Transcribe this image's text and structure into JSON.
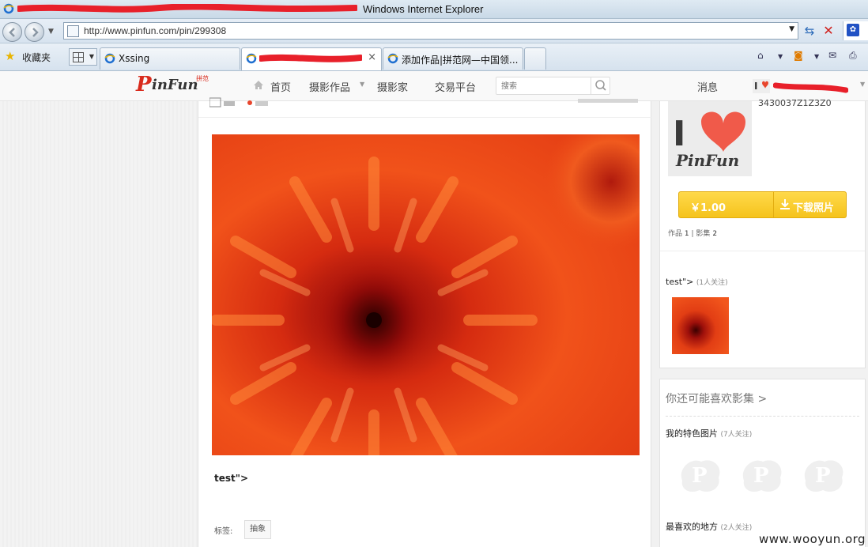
{
  "window": {
    "title_visible": "Windows Internet Explorer",
    "url": "http://www.pinfun.com/pin/299308"
  },
  "toolbar": {
    "favorites_label": "收藏夹"
  },
  "tabs": [
    {
      "label": "Xssing",
      "active": false
    },
    {
      "label": "",
      "active": true,
      "close": "×"
    },
    {
      "label": "添加作品|拼范网—中国领...",
      "active": false
    }
  ],
  "site_nav": {
    "logo_p": "P",
    "logo_rest": "inFun",
    "logo_cn": "拼范",
    "items": [
      "首页",
      "摄影作品",
      "摄影家",
      "交易平台"
    ],
    "search_placeholder": "搜索",
    "messages": "消息"
  },
  "work": {
    "title": "test\">",
    "tags_label": "标签:",
    "tag": "抽象"
  },
  "author": {
    "id_fragment": "3430037Z1Z3Z0",
    "price": "￥1.00",
    "download_label": "下载照片",
    "stats": {
      "works_label": "作品",
      "works": "1",
      "sep": "|",
      "albums_label": "影集",
      "albums": "2"
    }
  },
  "album": {
    "title": "test\">",
    "followers": "(1人关注)"
  },
  "recommend": {
    "title": "你还可能喜欢影集 >",
    "items": [
      {
        "title": "我的特色图片",
        "followers": "(7人关注)"
      },
      {
        "title": "最喜欢的地方",
        "followers": "(2人关注)"
      }
    ]
  },
  "watermark": "www.wooyun.org",
  "colors": {
    "brand_red": "#d92b1d",
    "buy_yellow": "#f5c31c",
    "ie_blue": "#2b6ab8"
  }
}
